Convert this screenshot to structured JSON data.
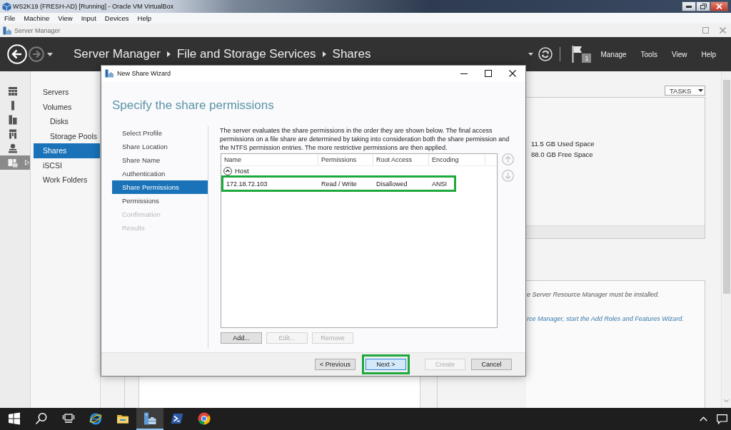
{
  "vm_window": {
    "title": "WS2K19 (FRESH-AD) [Running] - Oracle VM VirtualBox",
    "menu": [
      "File",
      "Machine",
      "View",
      "Input",
      "Devices",
      "Help"
    ]
  },
  "app_window": {
    "title": "Server Manager"
  },
  "header": {
    "breadcrumb": [
      "Server Manager",
      "File and Storage Services",
      "Shares"
    ],
    "notification_count": "1",
    "menu": [
      "Manage",
      "Tools",
      "View",
      "Help"
    ]
  },
  "icon_bar": [
    {
      "kind": "dashboard",
      "selected": false
    },
    {
      "kind": "local_server",
      "selected": false
    },
    {
      "kind": "all_servers",
      "selected": false
    },
    {
      "kind": "domain",
      "selected": false
    },
    {
      "kind": "network",
      "selected": false
    },
    {
      "kind": "storage",
      "selected": true
    }
  ],
  "sidebar": {
    "items": [
      {
        "label": "Servers",
        "selected": false
      },
      {
        "label": "Volumes",
        "selected": false,
        "children": [
          {
            "label": "Disks",
            "selected": false
          },
          {
            "label": "Storage Pools",
            "selected": false
          }
        ]
      },
      {
        "label": "Shares",
        "selected": true
      },
      {
        "label": "iSCSI",
        "selected": false
      },
      {
        "label": "Work Folders",
        "selected": false
      }
    ]
  },
  "content": {
    "tasks_button": "TASKS",
    "volume_stats": [
      "11.5 GB Used Space",
      "88.0 GB Free Space"
    ],
    "notice": "e Server Resource Manager must be installed.",
    "notice_link": "rce Manager, start the Add Roles and Features Wizard."
  },
  "wizard": {
    "title": "New Share Wizard",
    "heading": "Specify the share permissions",
    "steps": [
      {
        "label": "Select Profile",
        "selected": false,
        "disabled": false
      },
      {
        "label": "Share Location",
        "selected": false,
        "disabled": false
      },
      {
        "label": "Share Name",
        "selected": false,
        "disabled": false
      },
      {
        "label": "Authentication",
        "selected": false,
        "disabled": false
      },
      {
        "label": "Share Permissions",
        "selected": true,
        "disabled": false
      },
      {
        "label": "Permissions",
        "selected": false,
        "disabled": false
      },
      {
        "label": "Confirmation",
        "selected": false,
        "disabled": true
      },
      {
        "label": "Results",
        "selected": false,
        "disabled": true
      }
    ],
    "description": "The server evaluates the share permissions in the order they are shown below. The final access permissions on a file share are determined by taking into consideration both the share permission and the NTFS permission entries. The more restrictive permissions are then applied.",
    "table": {
      "columns": [
        "Name",
        "Permissions",
        "Root Access",
        "Encoding"
      ],
      "groups": [
        {
          "label": "Host",
          "expanded": true,
          "rows": [
            {
              "cells": [
                "172.18.72.103",
                "Read / Write",
                "Disallowed",
                "ANSI"
              ],
              "annotated": true
            }
          ]
        }
      ]
    },
    "order_buttons": [
      {
        "kind": "up",
        "disabled": true
      },
      {
        "kind": "down",
        "disabled": true
      }
    ],
    "list_buttons": [
      {
        "label": "Add...",
        "disabled": false
      },
      {
        "label": "Edit...",
        "disabled": true
      },
      {
        "label": "Remove",
        "disabled": true
      }
    ],
    "nav_buttons": [
      {
        "label": "< Previous",
        "disabled": false,
        "hover": false,
        "annotated": false
      },
      {
        "label": "Next >",
        "disabled": false,
        "hover": true,
        "annotated": true
      },
      {
        "label": "Create",
        "disabled": true,
        "hover": false,
        "annotated": false
      },
      {
        "label": "Cancel",
        "disabled": false,
        "hover": false,
        "annotated": false
      }
    ]
  },
  "taskbar": {
    "apps": [
      {
        "kind": "start",
        "selected": false
      },
      {
        "kind": "search",
        "selected": false
      },
      {
        "kind": "task_view",
        "selected": false
      },
      {
        "kind": "browser",
        "selected": false
      },
      {
        "kind": "files",
        "selected": false
      },
      {
        "kind": "server_manager",
        "selected": true
      },
      {
        "kind": "terminal",
        "selected": false
      },
      {
        "kind": "web",
        "selected": false
      }
    ]
  }
}
